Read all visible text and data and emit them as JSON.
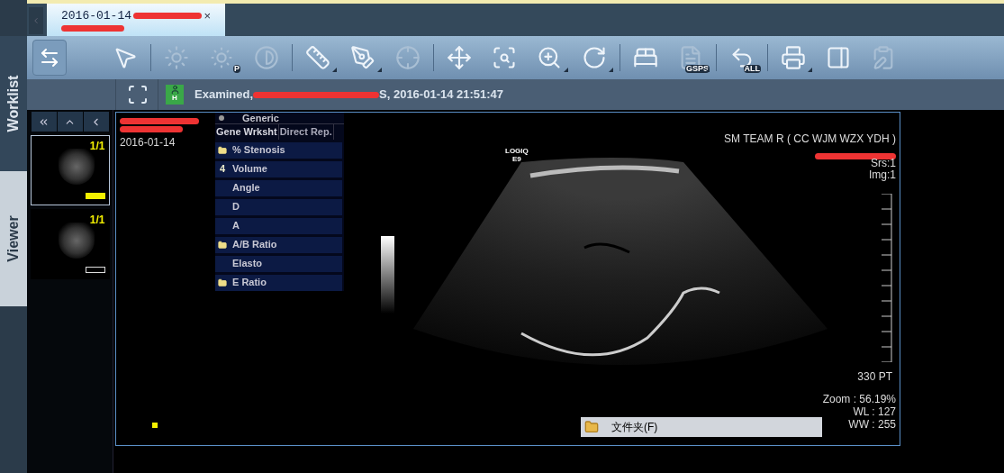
{
  "side_tabs": [
    {
      "label": "Worklist",
      "selected": false
    },
    {
      "label": "Viewer",
      "selected": true
    }
  ],
  "study_tab": {
    "title": "2016-01-14",
    "close": "×",
    "selected": true
  },
  "toolbar": {
    "link_button": {
      "pressed": true
    },
    "groups": [
      [
        {
          "disabled": false,
          "menu": false
        }
      ],
      [
        {
          "disabled": true,
          "menu": false
        },
        {
          "disabled": true,
          "menu": false,
          "badge_text": "P"
        },
        {
          "disabled": true,
          "menu": false
        }
      ],
      [
        {
          "disabled": false,
          "menu": true
        },
        {
          "disabled": false,
          "menu": true
        },
        {
          "disabled": true,
          "menu": false
        }
      ],
      [
        {
          "disabled": false,
          "menu": false
        },
        {
          "disabled": false,
          "menu": false
        },
        {
          "disabled": false,
          "menu": true
        },
        {
          "disabled": false,
          "menu": true
        }
      ],
      [
        {
          "disabled": false,
          "menu": false
        },
        {
          "disabled": true,
          "menu": true,
          "badge_text": "GSPS"
        }
      ],
      [
        {
          "disabled": false,
          "menu": false,
          "badge_text": "ALL"
        }
      ],
      [
        {
          "disabled": false,
          "menu": true
        },
        {
          "disabled": false,
          "menu": false
        },
        {
          "disabled": true,
          "menu": false
        }
      ]
    ]
  },
  "info_bar": {
    "badge": "H",
    "status_start": "Examined,",
    "status_end": "S, 2016-01-14 21:51:47"
  },
  "thumbnails": [
    {
      "count": "1/1",
      "selected": true,
      "marker_filled": true
    },
    {
      "count": "1/1",
      "selected": false,
      "marker_filled": false
    }
  ],
  "viewer": {
    "date": "2016-01-14",
    "probe": "LOGIQ",
    "probe_model": "E9",
    "institution": "SM TEAM R ( CC WJM WZX YDH )",
    "series": "Srs:1",
    "image": "Img:1",
    "depth_reading": "330 PT",
    "zoom": "Zoom : 56.19%",
    "wl": "WL : 127",
    "ww": "WW : 255",
    "measure_menu": {
      "header": "Generic",
      "tabs": [
        {
          "label": "Gene Wrksht",
          "selected": true
        },
        {
          "label": "Direct Rep.",
          "selected": false
        }
      ],
      "items": [
        {
          "kind": "folder",
          "label": "% Stenosis"
        },
        {
          "kind": "numbered",
          "number": "4",
          "label": "Volume"
        },
        {
          "kind": "plain",
          "label": "Angle"
        },
        {
          "kind": "plain",
          "label": "D"
        },
        {
          "kind": "plain",
          "label": "A"
        },
        {
          "kind": "folder",
          "label": "A/B Ratio"
        },
        {
          "kind": "plain",
          "label": "Elasto"
        },
        {
          "kind": "folder",
          "label": "E Ratio"
        }
      ]
    }
  },
  "context_menu": {
    "items": [
      {
        "label": "文件夹(F)"
      }
    ]
  }
}
